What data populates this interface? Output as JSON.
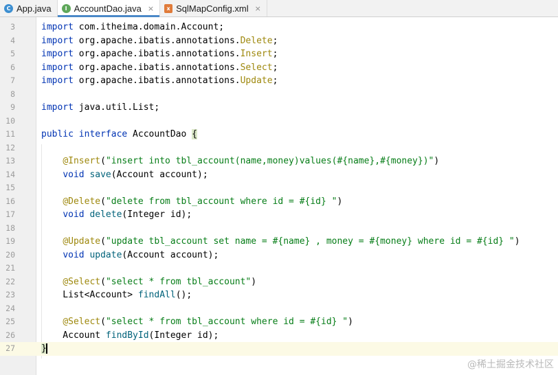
{
  "tabs": [
    {
      "label": "App.java",
      "icon": "class-file-icon",
      "active": false,
      "closable": false
    },
    {
      "label": "AccountDao.java",
      "icon": "interface-file-icon",
      "active": true,
      "closable": true
    },
    {
      "label": "SqlMapConfig.xml",
      "icon": "xml-file-icon",
      "active": false,
      "closable": true
    }
  ],
  "tab_close_glyph": "×",
  "colors": {
    "keyword": "#0033b3",
    "annotation": "#9e880d",
    "string": "#067d17",
    "method": "#00627a",
    "caret_line": "#fcfae5"
  },
  "lines": [
    {
      "n": "3",
      "seg": [
        [
          "kw",
          "import"
        ],
        [
          "p",
          " com.itheima.domain.Account;"
        ]
      ]
    },
    {
      "n": "4",
      "seg": [
        [
          "kw",
          "import"
        ],
        [
          "p",
          " org.apache.ibatis.annotations."
        ],
        [
          "ann",
          "Delete"
        ],
        [
          "p",
          ";"
        ]
      ]
    },
    {
      "n": "5",
      "seg": [
        [
          "kw",
          "import"
        ],
        [
          "p",
          " org.apache.ibatis.annotations."
        ],
        [
          "ann",
          "Insert"
        ],
        [
          "p",
          ";"
        ]
      ]
    },
    {
      "n": "6",
      "seg": [
        [
          "kw",
          "import"
        ],
        [
          "p",
          " org.apache.ibatis.annotations."
        ],
        [
          "ann",
          "Select"
        ],
        [
          "p",
          ";"
        ]
      ]
    },
    {
      "n": "7",
      "seg": [
        [
          "kw",
          "import"
        ],
        [
          "p",
          " org.apache.ibatis.annotations."
        ],
        [
          "ann",
          "Update"
        ],
        [
          "p",
          ";"
        ]
      ]
    },
    {
      "n": "8",
      "seg": []
    },
    {
      "n": "9",
      "seg": [
        [
          "kw",
          "import"
        ],
        [
          "p",
          " java.util.List;"
        ]
      ]
    },
    {
      "n": "10",
      "seg": []
    },
    {
      "n": "11",
      "seg": [
        [
          "kw",
          "public interface"
        ],
        [
          "p",
          " AccountDao "
        ],
        [
          "brace",
          "{"
        ]
      ]
    },
    {
      "n": "12",
      "seg": []
    },
    {
      "n": "13",
      "seg": [
        [
          "p",
          "    "
        ],
        [
          "ann",
          "@Insert"
        ],
        [
          "p",
          "("
        ],
        [
          "str",
          "\"insert into tbl_account(name,money)values(#{name},#{money})\""
        ],
        [
          "p",
          ")"
        ]
      ]
    },
    {
      "n": "14",
      "seg": [
        [
          "p",
          "    "
        ],
        [
          "kw",
          "void"
        ],
        [
          "p",
          " "
        ],
        [
          "meth",
          "save"
        ],
        [
          "p",
          "(Account account);"
        ]
      ]
    },
    {
      "n": "15",
      "seg": []
    },
    {
      "n": "16",
      "seg": [
        [
          "p",
          "    "
        ],
        [
          "ann",
          "@Delete"
        ],
        [
          "p",
          "("
        ],
        [
          "str",
          "\"delete from tbl_account where id = #{id} \""
        ],
        [
          "p",
          ")"
        ]
      ]
    },
    {
      "n": "17",
      "seg": [
        [
          "p",
          "    "
        ],
        [
          "kw",
          "void"
        ],
        [
          "p",
          " "
        ],
        [
          "meth",
          "delete"
        ],
        [
          "p",
          "(Integer id);"
        ]
      ]
    },
    {
      "n": "18",
      "seg": []
    },
    {
      "n": "19",
      "seg": [
        [
          "p",
          "    "
        ],
        [
          "ann",
          "@Update"
        ],
        [
          "p",
          "("
        ],
        [
          "str",
          "\"update tbl_account set name = #{name} , money = #{money} where id = #{id} \""
        ],
        [
          "p",
          ")"
        ]
      ]
    },
    {
      "n": "20",
      "seg": [
        [
          "p",
          "    "
        ],
        [
          "kw",
          "void"
        ],
        [
          "p",
          " "
        ],
        [
          "meth",
          "update"
        ],
        [
          "p",
          "(Account account);"
        ]
      ]
    },
    {
      "n": "21",
      "seg": []
    },
    {
      "n": "22",
      "seg": [
        [
          "p",
          "    "
        ],
        [
          "ann",
          "@Select"
        ],
        [
          "p",
          "("
        ],
        [
          "str",
          "\"select * from tbl_account\""
        ],
        [
          "p",
          ")"
        ]
      ]
    },
    {
      "n": "23",
      "seg": [
        [
          "p",
          "    List<Account> "
        ],
        [
          "meth",
          "findAll"
        ],
        [
          "p",
          "();"
        ]
      ]
    },
    {
      "n": "24",
      "seg": []
    },
    {
      "n": "25",
      "seg": [
        [
          "p",
          "    "
        ],
        [
          "ann",
          "@Select"
        ],
        [
          "p",
          "("
        ],
        [
          "str",
          "\"select * from tbl_account where id = #{id} \""
        ],
        [
          "p",
          ")"
        ]
      ]
    },
    {
      "n": "26",
      "seg": [
        [
          "p",
          "    Account "
        ],
        [
          "meth",
          "findById"
        ],
        [
          "p",
          "(Integer id);"
        ]
      ]
    },
    {
      "n": "27",
      "seg": [
        [
          "brace",
          "}"
        ]
      ],
      "caret": true
    }
  ],
  "watermark": "@稀土掘金技术社区"
}
